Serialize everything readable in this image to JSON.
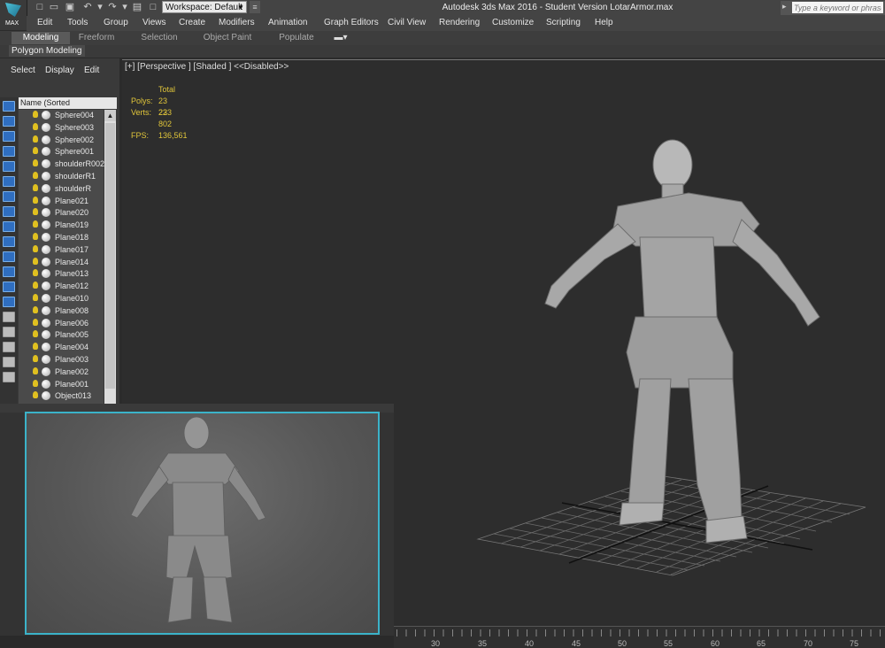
{
  "app": {
    "logo_text": "MAX",
    "title": "Autodesk 3ds Max 2016 - Student Version    LotarArmor.max",
    "workspace": "Workspace: Default",
    "search_placeholder": "Type a keyword or phrase"
  },
  "menu": [
    "Edit",
    "Tools",
    "Group",
    "Views",
    "Create",
    "Modifiers",
    "Animation",
    "Graph Editors",
    "Civil View",
    "Rendering",
    "Customize",
    "Scripting",
    "Help"
  ],
  "ribbon": {
    "tabs": [
      "Modeling",
      "Freeform",
      "Selection",
      "Object Paint",
      "Populate"
    ],
    "sub_label": "Polygon Modeling"
  },
  "scene_explorer": {
    "menus": [
      "Select",
      "Display",
      "Edit"
    ],
    "column_header": "Name (Sorted Descending)",
    "items": [
      "Sphere004",
      "Sphere003",
      "Sphere002",
      "Sphere001",
      "shoulderR002",
      "shoulderR1",
      "shoulderR",
      "Plane021",
      "Plane020",
      "Plane019",
      "Plane018",
      "Plane017",
      "Plane014",
      "Plane013",
      "Plane012",
      "Plane010",
      "Plane008",
      "Plane006",
      "Plane005",
      "Plane004",
      "Plane003",
      "Plane002",
      "Plane001",
      "Object013"
    ]
  },
  "viewport": {
    "label": "[+] [Perspective ] [Shaded ]  <<Disabled>>",
    "stats": {
      "header": "Total",
      "polys_label": "Polys:",
      "polys": "23 233",
      "verts_label": "Verts:",
      "verts": "22 802",
      "fps_label": "FPS:",
      "fps": "136,561"
    }
  },
  "timeline": {
    "ticks": [
      "30",
      "35",
      "40",
      "45",
      "50",
      "55",
      "60",
      "65",
      "70",
      "75"
    ]
  },
  "colors": {
    "accent": "#3bb3c9",
    "stats_text": "#e0c53a",
    "tool_blue": "#2f6ec0"
  }
}
